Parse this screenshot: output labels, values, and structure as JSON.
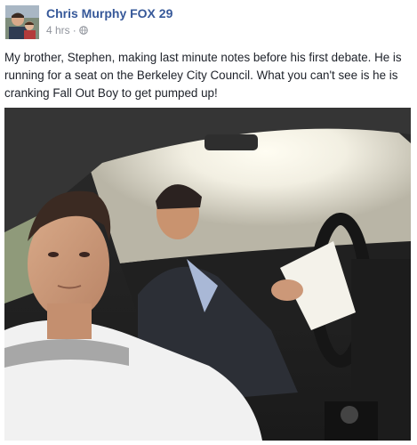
{
  "post": {
    "author": "Chris Murphy FOX 29",
    "timestamp": "4 hrs",
    "separator": "·",
    "privacy_icon": "globe-icon",
    "caption": "My brother, Stephen, making last minute notes before his first debate. He is running for a seat on the Berkeley City Council. What you can't see is he is cranking Fall Out Boy to get pumped up!",
    "photo_icon": "car-selfie-photo"
  },
  "colors": {
    "author_link": "#365899",
    "meta_text": "#90949c",
    "body_text": "#1d2129"
  }
}
